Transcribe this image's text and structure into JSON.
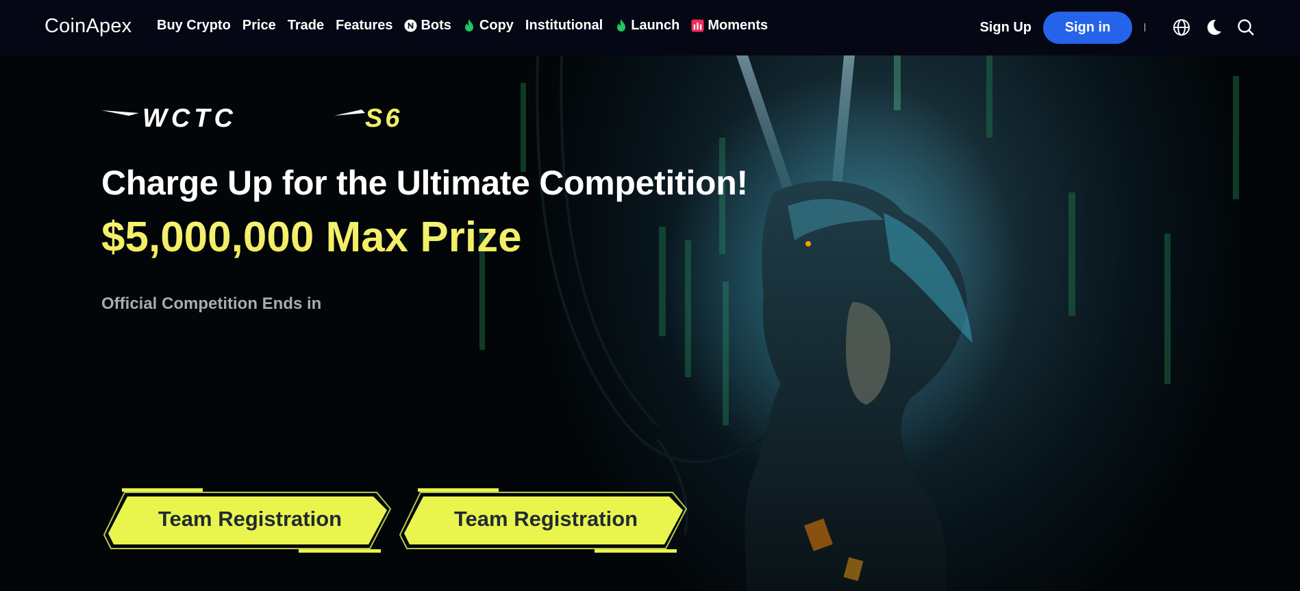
{
  "brand": "CoinApex",
  "nav": {
    "items": [
      {
        "label": "Buy Crypto",
        "icon": ""
      },
      {
        "label": "Price",
        "icon": ""
      },
      {
        "label": "Trade",
        "icon": ""
      },
      {
        "label": "Features",
        "icon": ""
      },
      {
        "label": "Bots",
        "icon": "bots-n-icon"
      },
      {
        "label": "Copy",
        "icon": "flame-icon"
      },
      {
        "label": "Institutional",
        "icon": ""
      },
      {
        "label": "Launch",
        "icon": "flame-icon"
      },
      {
        "label": "Moments",
        "icon": "moments-icon"
      }
    ],
    "sign_up": "Sign Up",
    "sign_in": "Sign in",
    "icons": [
      "globe-icon",
      "moon-icon",
      "search-icon"
    ]
  },
  "hero": {
    "logo_text": "WCTC",
    "logo_season": "S6",
    "headline": "Charge Up for the Ultimate Competition!",
    "prize": "$5,000,000 Max Prize",
    "countdown_label": "Official Competition Ends in",
    "buttons": [
      "Team Registration",
      "Team Registration"
    ]
  },
  "colors": {
    "nav_bg": "#050814",
    "accent_blue": "#2563eb",
    "prize_yellow": "#f4f36a",
    "button_fill": "#e9f54d",
    "flame_green": "#22c55e",
    "moments_red": "#ef2c5c"
  }
}
